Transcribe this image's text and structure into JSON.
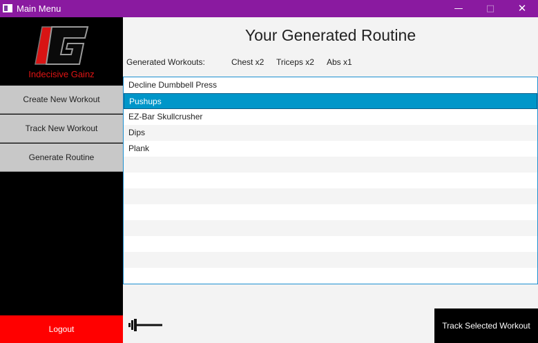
{
  "window": {
    "title": "Main Menu",
    "minimize_icon": "minimize-icon",
    "maximize_icon": "maximize-icon",
    "close_icon": "close-icon"
  },
  "sidebar": {
    "brand": "Indecisive Gainz",
    "items": [
      {
        "label": "Create New Workout"
      },
      {
        "label": "Track New Workout"
      },
      {
        "label": "Generate Routine"
      }
    ],
    "logout": "Logout"
  },
  "main": {
    "heading": "Your Generated Routine",
    "generated_label": "Generated Workouts:",
    "tags": [
      "Chest x2",
      "Triceps x2",
      "Abs x1"
    ],
    "workouts": [
      {
        "name": "Decline Dumbbell Press",
        "selected": false
      },
      {
        "name": "Pushups",
        "selected": true
      },
      {
        "name": "EZ-Bar Skullcrusher",
        "selected": false
      },
      {
        "name": "Dips",
        "selected": false
      },
      {
        "name": "Plank",
        "selected": false
      }
    ],
    "track_button": "Track Selected Workout"
  },
  "colors": {
    "titlebar": "#8a1aa0",
    "accent_red": "#ff0000",
    "selection": "#0096c9"
  }
}
